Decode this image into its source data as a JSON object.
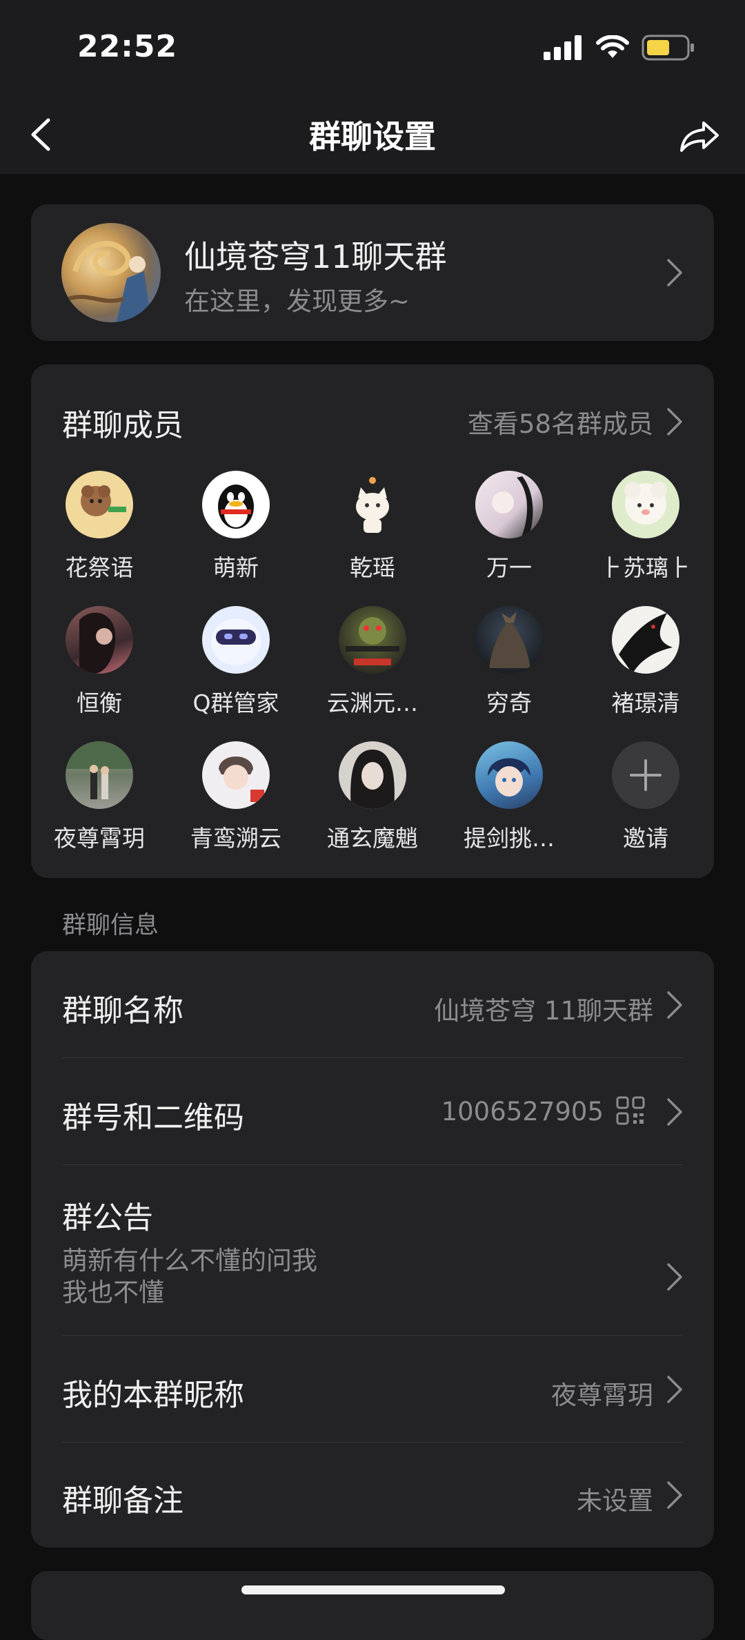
{
  "status_bar": {
    "time": "22:52"
  },
  "nav": {
    "title": "群聊设置"
  },
  "group": {
    "name": "仙境苍穹11聊天群",
    "subtitle": "在这里，发现更多~"
  },
  "members": {
    "title": "群聊成员",
    "view_all": "查看58名群成员",
    "list": [
      {
        "name": "花祭语"
      },
      {
        "name": "萌新"
      },
      {
        "name": "乾瑶"
      },
      {
        "name": "万一"
      },
      {
        "name": "⺊苏璃⺊"
      },
      {
        "name": "恒衡"
      },
      {
        "name": "Q群管家"
      },
      {
        "name": "云渊元…"
      },
      {
        "name": "穷奇"
      },
      {
        "name": "褚璟清"
      },
      {
        "name": "夜尊霄玥"
      },
      {
        "name": "青鸾溯云"
      },
      {
        "name": "通玄魔魈"
      },
      {
        "name": "提剑挑…"
      }
    ],
    "invite_label": "邀请"
  },
  "info": {
    "section_label": "群聊信息",
    "group_name_label": "群聊名称",
    "group_name_value": "仙境苍穹 11聊天群",
    "group_id_label": "群号和二维码",
    "group_id_value": "1006527905",
    "notice_label": "群公告",
    "notice_line1": "萌新有什么不懂的问我",
    "notice_line2": "我也不懂",
    "nickname_label": "我的本群昵称",
    "nickname_value": "夜尊霄玥",
    "remark_label": "群聊备注",
    "remark_value": "未设置"
  },
  "colors": {
    "background": "#0f0f10",
    "card": "#232325",
    "header": "#1c1c1e",
    "battery": "#f5d547"
  },
  "icons": [
    "back-arrow-icon",
    "share-arrow-icon",
    "chevron-right-icon",
    "qr-code-icon",
    "plus-icon",
    "signal-icon",
    "wifi-icon",
    "battery-icon"
  ]
}
